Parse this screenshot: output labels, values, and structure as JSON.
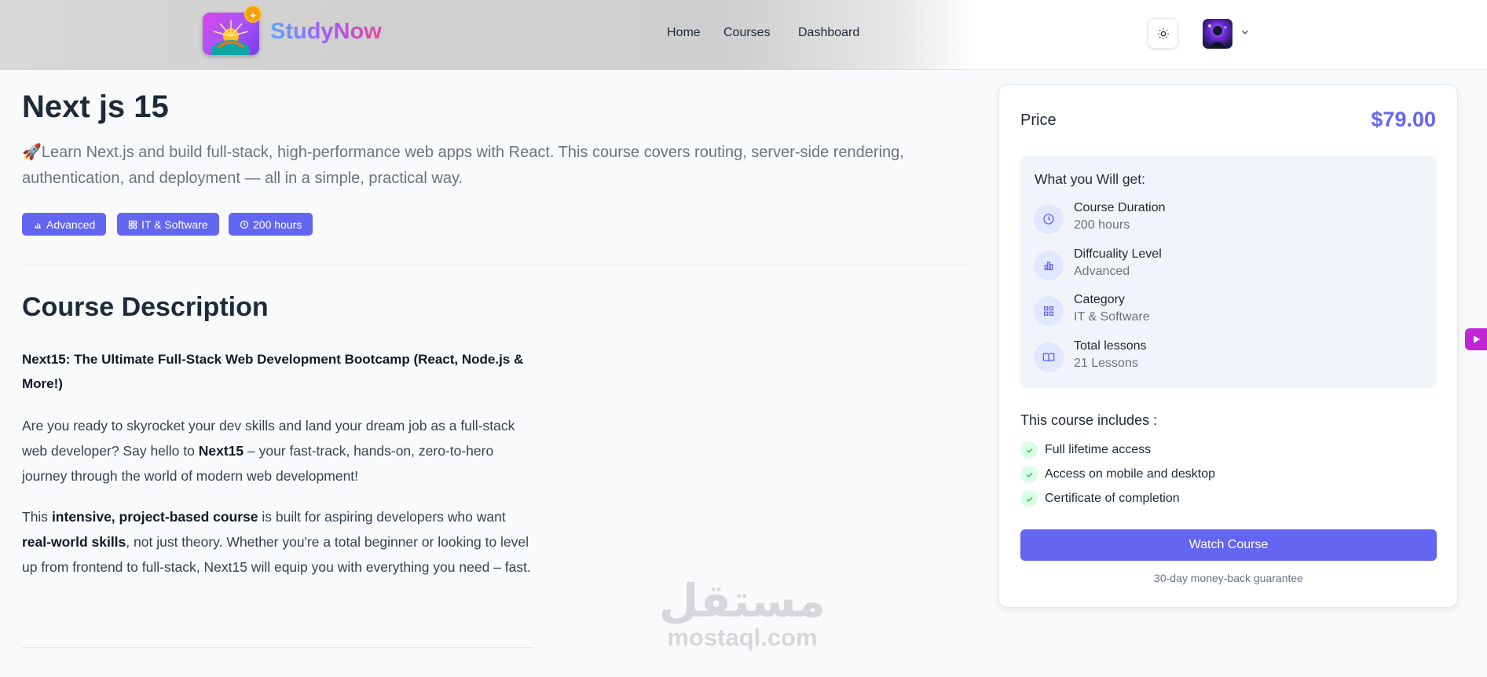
{
  "header": {
    "brand": "StudyNow",
    "nav": [
      {
        "label": "Home"
      },
      {
        "label": "Courses"
      },
      {
        "label": "Dashboard"
      }
    ],
    "icons": {
      "theme": "sun-icon",
      "chevron": "chevron-down-icon"
    }
  },
  "course": {
    "title": "Next js 15",
    "subtitle": "🚀Learn Next.js and build full-stack, high-performance web apps with React. This course covers routing, server-side rendering, authentication, and deployment — all in a simple, practical way.",
    "tags": [
      {
        "label": "Advanced",
        "icon": "bar-chart-icon"
      },
      {
        "label": "IT & Software",
        "icon": "grid-icon"
      },
      {
        "label": "200 hours",
        "icon": "clock-icon"
      }
    ]
  },
  "description": {
    "heading": "Course Description",
    "bold_head": "Next15: The Ultimate Full-Stack Web Development Bootcamp (React, Node.js & More!)",
    "p1": {
      "a": "Are you ready to skyrocket your dev skills and land your dream job as a full-stack web developer? Say hello to ",
      "b": "Next15",
      "c": " – your fast-track, hands-on, zero-to-hero journey through the world of modern web development!"
    },
    "p2": {
      "a": "This ",
      "b": "intensive, project-based course",
      "c": " is built for aspiring developers who want ",
      "d": "real-world skills",
      "e": ", not just theory. Whether you're a total beginner or looking to level up from frontend to full-stack, Next15 will equip you with everything you need – fast."
    }
  },
  "watermark": {
    "arabic": "مستقل",
    "latin": "mostaql.com"
  },
  "sidebar": {
    "price_label": "Price",
    "price_value": "$79.00",
    "get_title": "What you Will get:",
    "get_items": [
      {
        "label": "Course Duration",
        "value": "200 hours",
        "icon": "clock-icon"
      },
      {
        "label": "Diffcuality Level",
        "value": "Advanced",
        "icon": "bar-chart-icon"
      },
      {
        "label": "Category",
        "value": "IT & Software",
        "icon": "grid-icon"
      },
      {
        "label": "Total lessons",
        "value": "21 Lessons",
        "icon": "book-icon"
      }
    ],
    "includes_title": "This course includes :",
    "includes": [
      {
        "label": "Full lifetime access"
      },
      {
        "label": "Access on mobile and desktop"
      },
      {
        "label": "Certificate of completion"
      }
    ],
    "button": "Watch Course",
    "guarantee": "30-day money-back guarantee"
  },
  "colors": {
    "accent": "#6366f1",
    "check": "#22c55e",
    "side_tab": "#c026d3"
  }
}
